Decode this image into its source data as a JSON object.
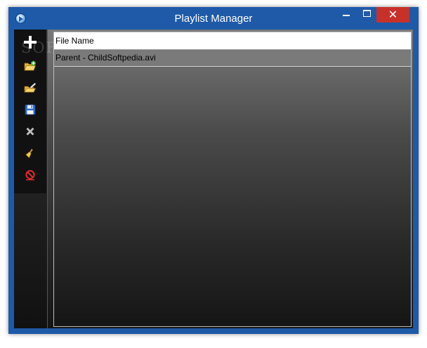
{
  "window": {
    "title": "Playlist Manager"
  },
  "watermark": {
    "text": "SOFTPEDIA"
  },
  "toolbar": {
    "items": [
      {
        "icon": "add-icon"
      },
      {
        "icon": "open-folder-icon"
      },
      {
        "icon": "open-folder-edit-icon"
      },
      {
        "icon": "save-icon"
      },
      {
        "icon": "remove-icon"
      },
      {
        "icon": "clear-broom-icon"
      },
      {
        "icon": "stop-icon"
      }
    ]
  },
  "list": {
    "columns": [
      "File Name"
    ],
    "rows": [
      {
        "file_name": "Parent - ChildSoftpedia.avi"
      }
    ]
  },
  "colors": {
    "titlebar": "#1e5aa8",
    "close_button": "#c7312a",
    "selected_row": "#7a7a7a"
  }
}
